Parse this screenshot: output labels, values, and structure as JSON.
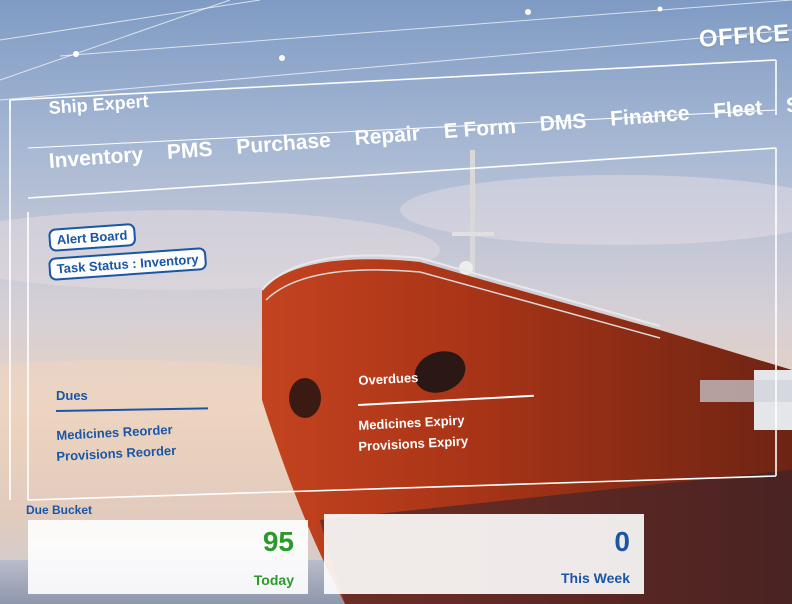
{
  "header": {
    "office_label": "OFFICE",
    "app_title": "Ship Expert"
  },
  "menu": [
    {
      "label": "Inventory"
    },
    {
      "label": "PMS"
    },
    {
      "label": "Purchase"
    },
    {
      "label": "Repair"
    },
    {
      "label": "E Form"
    },
    {
      "label": "DMS"
    },
    {
      "label": "Finance"
    },
    {
      "label": "Fleet"
    },
    {
      "label": "Sa"
    }
  ],
  "buttons": {
    "alert_board": "Alert Board",
    "task_status": "Task Status : Inventory"
  },
  "dues": {
    "title": "Dues",
    "items": [
      "Medicines Reorder",
      "Provisions Reorder"
    ]
  },
  "overdues": {
    "title": "Overdues",
    "items": [
      "Medicines Expiry",
      "Provisions Expiry"
    ]
  },
  "due_bucket": {
    "title": "Due Bucket",
    "today": {
      "value": "95",
      "label": "Today"
    },
    "this_week": {
      "value": "0",
      "label": "This Week"
    }
  },
  "colors": {
    "accent": "#1a56a6",
    "green": "#2a9a2a",
    "hull": "#b13a1f"
  }
}
